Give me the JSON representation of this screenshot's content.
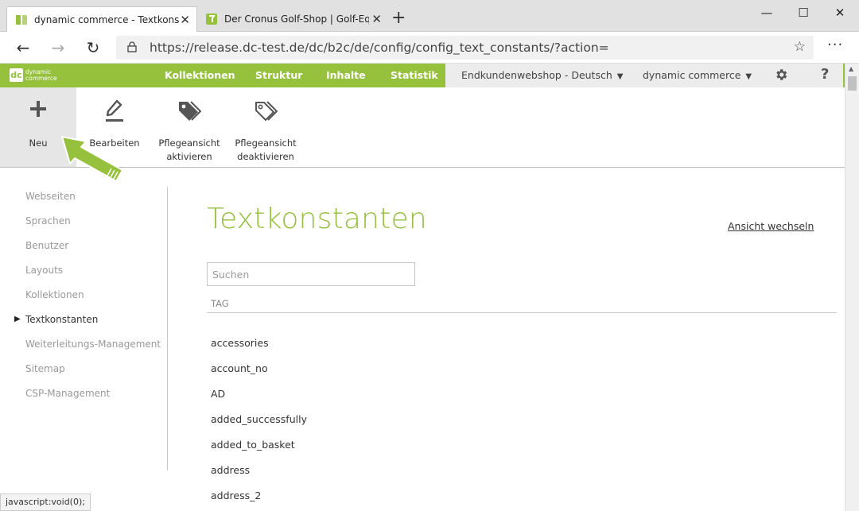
{
  "browser": {
    "tabs": [
      {
        "title": "dynamic commerce - Textkonstanten",
        "active": true
      },
      {
        "title": "Der Cronus Golf-Shop | Golf-Equipment",
        "active": false
      }
    ],
    "url": "https://release.dc-test.de/dc/b2c/de/config/config_text_constants/?action=",
    "status_text": "javascript:void(0);"
  },
  "app": {
    "logo_text_1": "dynamic",
    "logo_text_2": "commerce",
    "nav": [
      "Kollektionen",
      "Struktur",
      "Inhalte",
      "Statistik"
    ],
    "shop_select": "Endkundenwebshop - Deutsch",
    "company_select": "dynamic commerce",
    "help": "?"
  },
  "toolbar": {
    "new": "Neu",
    "edit": "Bearbeiten",
    "activate_1": "Pflegeansicht",
    "activate_2": "aktivieren",
    "deactivate_1": "Pflegeansicht",
    "deactivate_2": "deaktivieren"
  },
  "sidebar": {
    "items": [
      "Webseiten",
      "Sprachen",
      "Benutzer",
      "Layouts",
      "Kollektionen",
      "Textkonstanten",
      "Weiterleitungs-Management",
      "Sitemap",
      "CSP-Management"
    ],
    "active_index": 5
  },
  "main": {
    "title": "Textkonstanten",
    "switch_view": "Ansicht wechseln",
    "search_placeholder": "Suchen",
    "column_header": "TAG",
    "rows": [
      "accessories",
      "account_no",
      "AD",
      "added_successfully",
      "added_to_basket",
      "address",
      "address_2"
    ]
  },
  "colors": {
    "brand_green": "#95c13d"
  }
}
